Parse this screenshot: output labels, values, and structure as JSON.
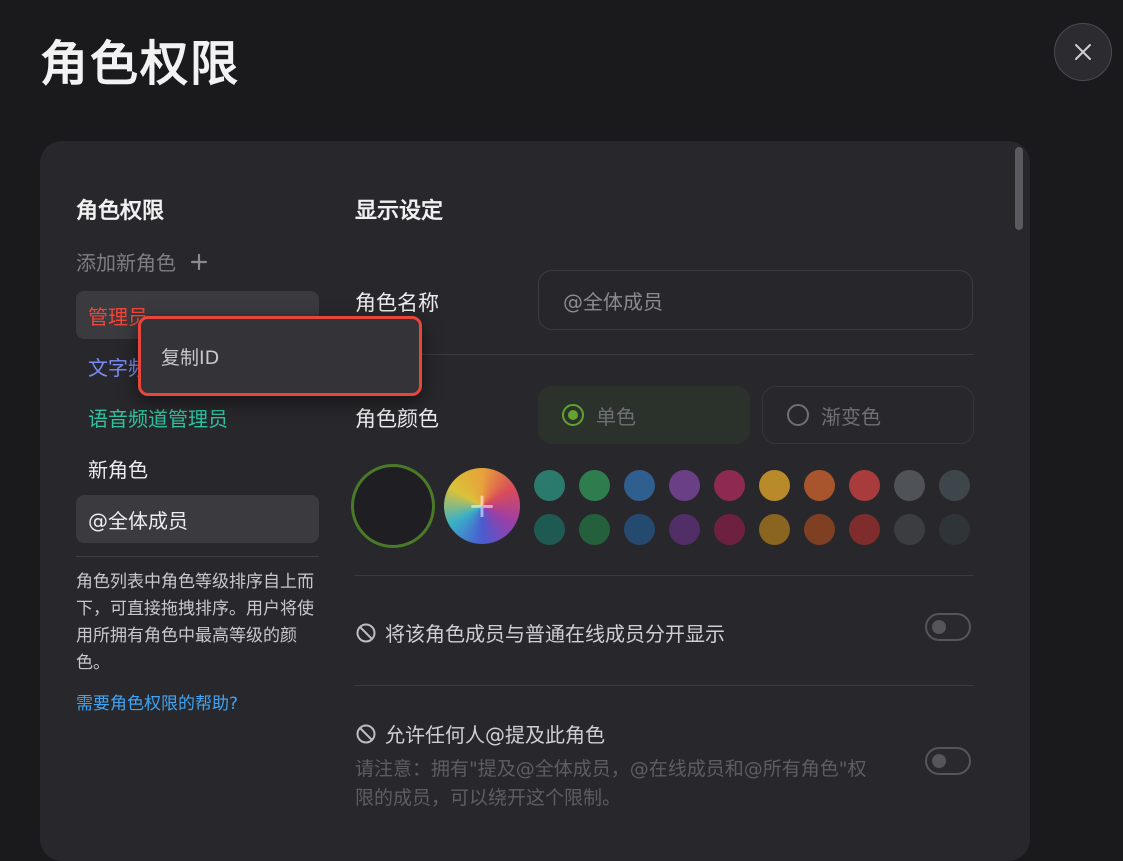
{
  "page_title": "角色权限",
  "close_icon": "close-icon",
  "left": {
    "heading": "角色权限",
    "add_role_label": "添加新角色",
    "add_icon": "plus-icon",
    "roles": [
      {
        "label": "管理员",
        "color": "#f0463a"
      },
      {
        "label": "文字频",
        "color": "#7a8cf5"
      },
      {
        "label": "语音频道管理员",
        "color": "#2fc2a0"
      },
      {
        "label": "新角色",
        "color": "#ececec"
      },
      {
        "label": "@全体成员",
        "color": "#ececec"
      }
    ],
    "hint": "角色列表中角色等级排序自上而下，可直接拖拽排序。用户将使用所拥有角色中最高等级的颜色。",
    "help_link": "需要角色权限的帮助?"
  },
  "right": {
    "heading": "显示设定",
    "name_label": "角色名称",
    "name_value": "@全体成员",
    "color_label": "角色颜色",
    "color_single": "单色",
    "color_gradient": "渐变色",
    "custom_color_icon": "plus-icon",
    "swatches_row1": [
      "#2b7a6e",
      "#2f7d4e",
      "#2f5f8e",
      "#6b3f86",
      "#8e2a52",
      "#b88a2a",
      "#a8552e",
      "#a83c3c",
      "#4f5256",
      "#3e464c"
    ],
    "swatches_row2": [
      "#1f5a52",
      "#25603d",
      "#244a70",
      "#512f66",
      "#6e2040",
      "#8a6520",
      "#7e3f22",
      "#7e2c2c",
      "#3b3d40",
      "#2e3438"
    ],
    "perm_separate_label": "将该角色成员与普通在线成员分开显示",
    "perm_mention_label": "允许任何人@提及此角色",
    "perm_mention_note": "请注意：拥有\"提及@全体成员，@在线成员和@所有角色\"权限的成员，可以绕开这个限制。",
    "perm_icon": "prohibited-icon"
  },
  "context_menu": {
    "copy_id": "复制ID"
  }
}
